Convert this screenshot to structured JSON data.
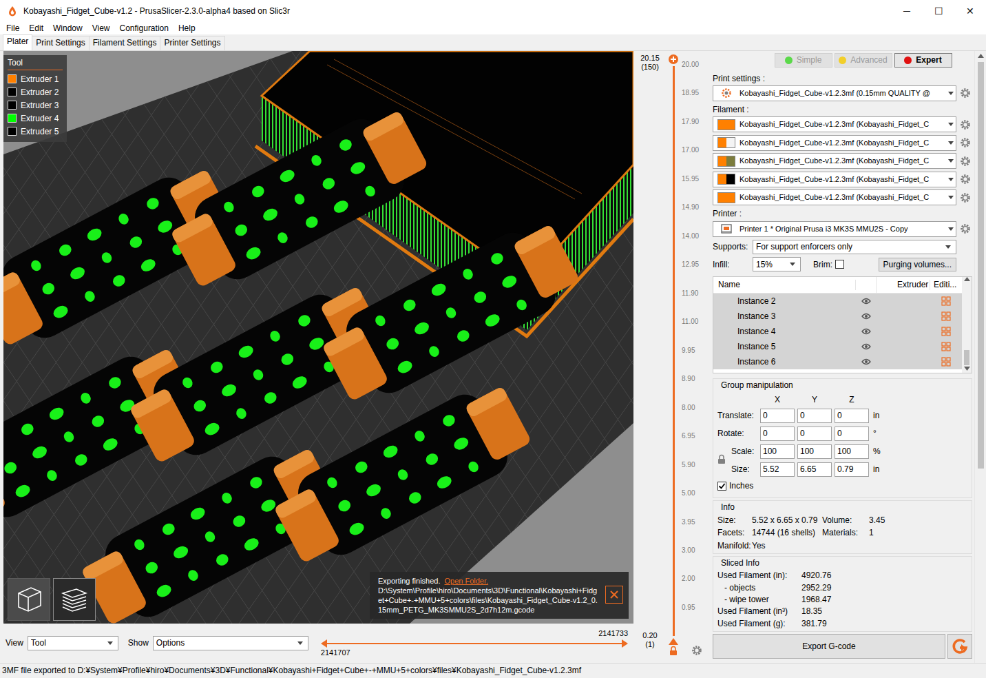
{
  "window": {
    "title": "Kobayashi_Fidget_Cube-v1.2 - PrusaSlicer-2.3.0-alpha4 based on Slic3r",
    "controls": [
      "─",
      "☐",
      "✕"
    ]
  },
  "menu": [
    "File",
    "Edit",
    "Window",
    "View",
    "Configuration",
    "Help"
  ],
  "tabs": [
    {
      "label": "Plater",
      "selected": true
    },
    {
      "label": "Print Settings",
      "selected": false
    },
    {
      "label": "Filament Settings",
      "selected": false
    },
    {
      "label": "Printer Settings",
      "selected": false
    }
  ],
  "viewport": {
    "legend": {
      "title": "Tool",
      "items": [
        {
          "label": "Extruder 1",
          "color": "#ff8000"
        },
        {
          "label": "Extruder 2",
          "color": "#000000"
        },
        {
          "label": "Extruder 3",
          "color": "#000000"
        },
        {
          "label": "Extruder 4",
          "color": "#00ff00"
        },
        {
          "label": "Extruder 5",
          "color": "#000000"
        }
      ]
    },
    "view_modes": [
      {
        "kind": "3d",
        "selected": false
      },
      {
        "kind": "layers",
        "selected": true
      }
    ],
    "notification": {
      "title": "Exporting finished.",
      "link": "Open Folder.",
      "path": "D:\\System\\Profile\\hiro\\Documents\\3D\\Functional\\Kobayashi+Fidget+Cube+-+MMU+5+colors\\files\\Kobayashi_Fidget_Cube-v1.2_0.15mm_PETG_MK3SMMU2S_2d7h12m.gcode"
    }
  },
  "bottom": {
    "view_label": "View",
    "view_value": "Tool",
    "show_label": "Show",
    "show_value": "Options",
    "range_low": "2141707",
    "range_high": "2141733",
    "level_low": 0,
    "level_high": 1
  },
  "layer_slider": {
    "top_value": "20.15",
    "top_layer": "(150)",
    "bottom_value": "0.20",
    "bottom_layer": "(1)",
    "level": 1,
    "ticks": [
      "20.00",
      "18.95",
      "17.90",
      "17.00",
      "15.95",
      "14.90",
      "14.00",
      "12.95",
      "11.90",
      "11.00",
      "9.95",
      "8.90",
      "8.00",
      "6.95",
      "5.90",
      "5.00",
      "3.95",
      "3.00",
      "2.00",
      "0.95"
    ]
  },
  "mode_buttons": [
    {
      "label": "Simple",
      "color": "#5bd94a",
      "selected": false
    },
    {
      "label": "Advanced",
      "color": "#f2cf2a",
      "selected": false
    },
    {
      "label": "Expert",
      "color": "#e01010",
      "selected": true
    }
  ],
  "print_settings": {
    "label": "Print settings :",
    "value": "Kobayashi_Fidget_Cube-v1.2.3mf (0.15mm QUALITY @"
  },
  "filament": {
    "label": "Filament :",
    "items": [
      {
        "value": "Kobayashi_Fidget_Cube-v1.2.3mf (Kobayashi_Fidget_C",
        "colors": [
          "#ff8000",
          "#ff8000"
        ]
      },
      {
        "value": "Kobayashi_Fidget_Cube-v1.2.3mf (Kobayashi_Fidget_C",
        "colors": [
          "#ff8000",
          "#f4f4f4"
        ]
      },
      {
        "value": "Kobayashi_Fidget_Cube-v1.2.3mf (Kobayashi_Fidget_C",
        "colors": [
          "#ff8000",
          "#7c7c3c"
        ]
      },
      {
        "value": "Kobayashi_Fidget_Cube-v1.2.3mf (Kobayashi_Fidget_C",
        "colors": [
          "#ff8000",
          "#000000"
        ]
      },
      {
        "value": "Kobayashi_Fidget_Cube-v1.2.3mf (Kobayashi_Fidget_C",
        "colors": [
          "#ff8000",
          "#ff8000"
        ]
      }
    ]
  },
  "printer": {
    "label": "Printer :",
    "value": "Printer 1 * Original Prusa i3 MK3S MMU2S - Copy"
  },
  "supports": {
    "label": "Supports:",
    "value": "For support enforcers only"
  },
  "infill": {
    "label": "Infill:",
    "value": "15%"
  },
  "brim": {
    "label": "Brim:",
    "checked": false
  },
  "purging_button": "Purging volumes...",
  "object_list": {
    "columns": [
      "Name",
      "Extruder",
      "Editi..."
    ],
    "rows": [
      {
        "name": "Instance 2",
        "selected": true
      },
      {
        "name": "Instance 3",
        "selected": true
      },
      {
        "name": "Instance 4",
        "selected": true
      },
      {
        "name": "Instance 5",
        "selected": true
      },
      {
        "name": "Instance 6",
        "selected": true
      }
    ]
  },
  "group": {
    "title": "Group manipulation",
    "axes": [
      "X",
      "Y",
      "Z"
    ],
    "rows": [
      {
        "label": "Translate:",
        "values": [
          "0",
          "0",
          "0"
        ],
        "unit": "in"
      },
      {
        "label": "Rotate:",
        "values": [
          "0",
          "0",
          "0"
        ],
        "unit": "°"
      },
      {
        "label": "Scale:",
        "values": [
          "100",
          "100",
          "100"
        ],
        "unit": "%"
      },
      {
        "label": "Size:",
        "values": [
          "5.52",
          "6.65",
          "0.79"
        ],
        "unit": "in"
      }
    ],
    "inches": {
      "label": "Inches",
      "checked": true
    }
  },
  "info": {
    "title": "Info",
    "items": [
      {
        "label": "Size:",
        "value": "5.52 x 6.65 x 0.79"
      },
      {
        "label": "Volume:",
        "value": "3.45"
      },
      {
        "label": "Facets:",
        "value": "14744 (16 shells)"
      },
      {
        "label": "Materials:",
        "value": "1"
      },
      {
        "label": "Manifold:",
        "value": "Yes"
      }
    ]
  },
  "sliced_info": {
    "title": "Sliced Info",
    "rows": [
      {
        "label": "Used Filament (in):",
        "value": "4920.76",
        "kind": "main"
      },
      {
        "label": "- objects",
        "value": "2952.29",
        "kind": "sub"
      },
      {
        "label": "- wipe tower",
        "value": "1968.47",
        "kind": "sub"
      },
      {
        "label": "Used Filament (in³)",
        "value": "18.35",
        "kind": "main"
      },
      {
        "label": "Used Filament (g):",
        "value": "381.79",
        "kind": "main"
      }
    ]
  },
  "export_button": "Export G-code",
  "status": "3MF file exported to D:¥System¥Profile¥hiro¥Documents¥3D¥Functional¥Kobayashi+Fidget+Cube+-+MMU+5+colors¥files¥Kobayashi_Fidget_Cube-v1.2.3mf"
}
